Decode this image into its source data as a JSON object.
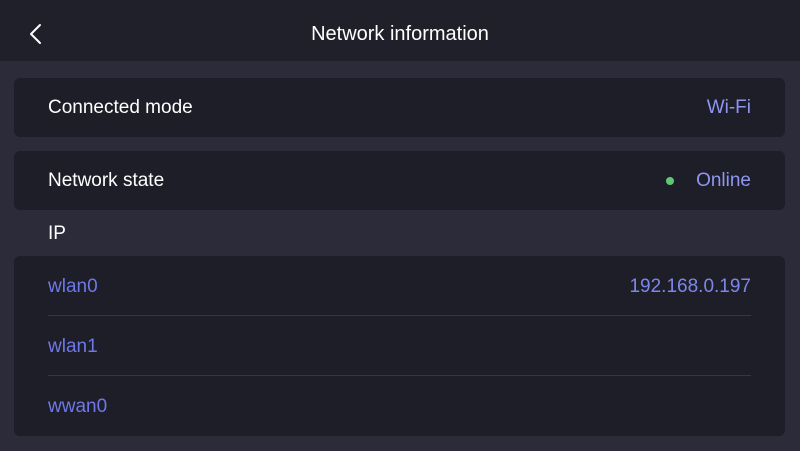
{
  "header": {
    "title": "Network information",
    "back_icon": "chevron-left-icon"
  },
  "connected_mode": {
    "label": "Connected mode",
    "value": "Wi-Fi"
  },
  "network_state": {
    "label": "Network state",
    "value": "Online",
    "status_color": "#5fc971"
  },
  "ip_section": {
    "label": "IP",
    "interfaces": [
      {
        "name": "wlan0",
        "address": "192.168.0.197"
      },
      {
        "name": "wlan1",
        "address": ""
      },
      {
        "name": "wwan0",
        "address": ""
      }
    ]
  },
  "colors": {
    "background": "#2c2b3a",
    "header_background": "#20202b",
    "card_background": "#1e1e29",
    "accent": "#8e96f0"
  }
}
